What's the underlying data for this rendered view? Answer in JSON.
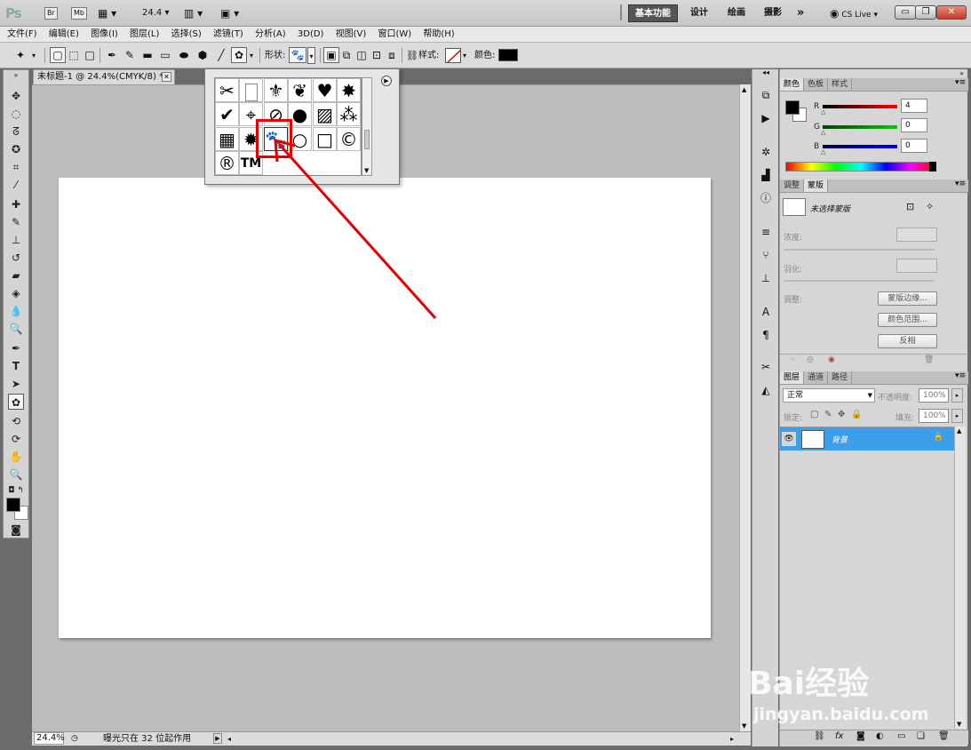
{
  "app": {
    "logo": "Ps",
    "bridge": "Br",
    "minibridge": "Mb",
    "zoom": "24.4",
    "workspaces": [
      "基本功能",
      "设计",
      "绘画",
      "摄影"
    ],
    "more": "»",
    "cslive": "CS Live"
  },
  "menu": [
    "文件(F)",
    "编辑(E)",
    "图像(I)",
    "图层(L)",
    "选择(S)",
    "滤镜(T)",
    "分析(A)",
    "3D(D)",
    "视图(V)",
    "窗口(W)",
    "帮助(H)"
  ],
  "options": {
    "shape_label": "形状:",
    "style_label": "样式:",
    "color_label": "颜色:",
    "color_value": "#000000"
  },
  "document": {
    "tab_title": "未标题-1 @ 24.4%(CMYK/8) *",
    "zoom": "24.4%",
    "status": "曝光只在 32 位起作用"
  },
  "shape_picker": {
    "shapes": [
      "scissors-icon",
      "blank-page-icon",
      "fleur-de-lis-icon",
      "ornament-icon",
      "heart-icon",
      "splat-icon",
      "checkmark-icon",
      "target-icon",
      "no-sign-icon",
      "speech-bubble-icon",
      "hatch-pattern-icon",
      "diamond-grid-icon",
      "grid-icon",
      "starburst-icon",
      "paw-print-icon",
      "circle-icon",
      "square-frame-icon",
      "copyright-icon",
      "registered-icon",
      "trademark-icon"
    ],
    "selected_shape": "paw-print-icon"
  },
  "color_panel": {
    "tabs": [
      "颜色",
      "色板",
      "样式"
    ],
    "r_label": "R",
    "r_value": "4",
    "g_label": "G",
    "g_value": "0",
    "b_label": "B",
    "b_value": "0"
  },
  "masks_panel": {
    "tabs": [
      "调整",
      "蒙版"
    ],
    "no_mask": "未选择蒙版",
    "density": "浓度:",
    "feather": "羽化:",
    "refine": "调整:",
    "btn_edge": "蒙版边缘...",
    "btn_color_range": "颜色范围...",
    "btn_invert": "反相"
  },
  "layers_panel": {
    "tabs": [
      "图层",
      "通道",
      "路径"
    ],
    "blend_mode": "正常",
    "opacity_label": "不透明度:",
    "opacity_value": "100%",
    "lock_label": "锁定:",
    "fill_label": "填充:",
    "fill_value": "100%",
    "layer_name": "背景"
  },
  "watermark": {
    "brand": "Bai经验",
    "url": "jingyan.baidu.com"
  },
  "colors": {
    "accent_selected_layer": "#3d9fea",
    "highlight": "#e40000"
  }
}
